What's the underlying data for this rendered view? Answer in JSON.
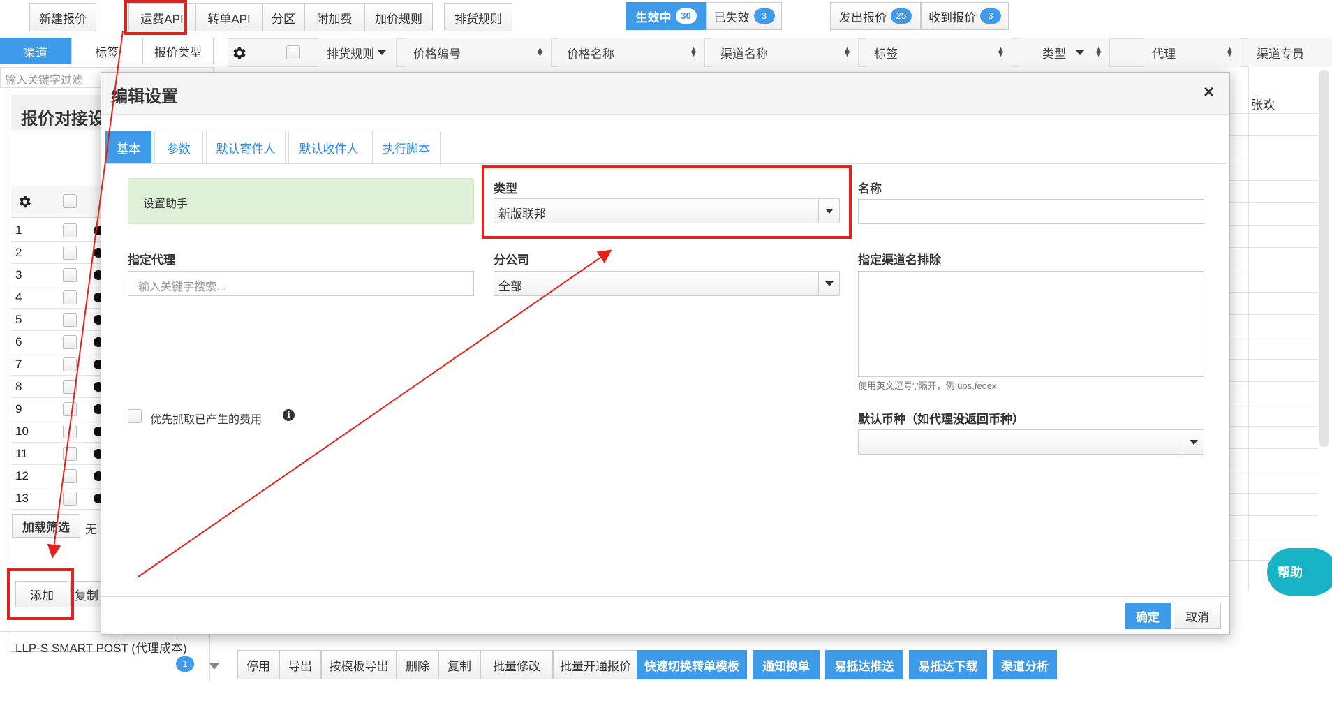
{
  "toolbar": {
    "new_quote": "新建报价",
    "freight_api": "运费API",
    "transfer_api": "转单API",
    "zone": "分区",
    "surcharge": "附加费",
    "markup_rule": "加价规则",
    "sort_rule": "排货规则"
  },
  "status_tabs": {
    "active_label": "生效中",
    "active_count": "30",
    "expired_label": "已失效",
    "expired_count": "3"
  },
  "quote_tabs": {
    "sent_label": "发出报价",
    "sent_count": "25",
    "received_label": "收到报价",
    "received_count": "3"
  },
  "left_tabs": [
    "渠道",
    "标签",
    "报价类型"
  ],
  "left_filter_placeholder": "输入关键字过滤",
  "behind_panel": {
    "title": "报价对接设",
    "rows": [
      "1",
      "2",
      "3",
      "4",
      "5",
      "6",
      "7",
      "8",
      "9",
      "10",
      "11",
      "12",
      "13"
    ],
    "load_filter": "加载筛选",
    "none_label": "无",
    "add": "添加",
    "copy": "复制"
  },
  "left_bottom_item": {
    "label": "LLP-S SMART POST (代理成本)",
    "count": "1"
  },
  "table": {
    "columns": [
      "排货规则",
      "价格编号",
      "价格名称",
      "渠道名称",
      "标签",
      "类型",
      "代理",
      "渠道专员"
    ],
    "first_row_specialist": "张欢"
  },
  "bottom_buttons": [
    "停用",
    "导出",
    "按模板导出",
    "删除",
    "复制",
    "批量修改",
    "批量开通报价"
  ],
  "bottom_blue_buttons": [
    "快速切换转单模板",
    "通知换单",
    "易抵达推送",
    "易抵达下载",
    "渠道分析"
  ],
  "help_label": "帮助",
  "modal": {
    "title": "编辑设置",
    "close": "×",
    "tabs": [
      "基本",
      "参数",
      "默认寄件人",
      "默认收件人",
      "执行脚本"
    ],
    "helper_text": "设置助手",
    "type_label": "类型",
    "type_value": "新版联邦",
    "name_label": "名称",
    "name_value": "",
    "agent_label": "指定代理",
    "agent_placeholder": "输入关键字搜索...",
    "branch_label": "分公司",
    "branch_value": "全部",
    "exclude_label": "指定渠道名排除",
    "exclude_hint": "使用英文逗号','隔开，例:ups,fedex",
    "priority_label": "优先抓取已产生的费用",
    "currency_label": "默认币种（如代理没返回币种）",
    "currency_value": "",
    "ok": "确定",
    "cancel": "取消"
  },
  "colors": {
    "accent": "#3d9be9",
    "annotation_red": "#e4211b",
    "helper_bg": "#dff0d8",
    "help_bubble": "#17b3c6"
  }
}
